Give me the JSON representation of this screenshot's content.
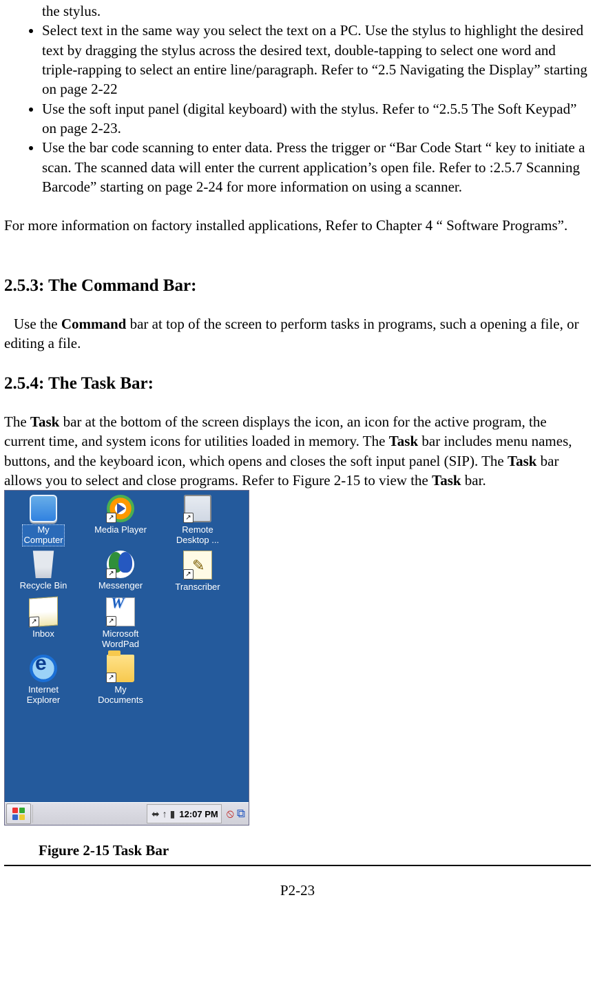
{
  "bullets": {
    "partial": "the stylus.",
    "b1": "Select text in the same way you select the text on a PC. Use the stylus to highlight the desired text by dragging the stylus across the desired text, double-tapping to select one word and triple-rapping to select an entire line/paragraph. Refer to “2.5 Navigating the Display” starting on page 2-22",
    "b2": "Use the soft input panel (digital keyboard) with the stylus. Refer to “2.5.5 The Soft Keypad” on page 2-23.",
    "b3": "Use the bar code scanning to enter data. Press the trigger or “Bar Code Start “ key to initiate a scan. The scanned data will enter the current application’s open file. Refer to :2.5.7 Scanning Barcode” starting on page 2-24 for more information on using a scanner."
  },
  "para_more_info": "For more information on factory installed applications, Refer to Chapter 4 “ Software Programs”.",
  "heading_253": "2.5.3: The Command Bar:",
  "para_253_pre": "Use the ",
  "para_253_bold": "Command",
  "para_253_post": " bar at top of the screen to perform tasks in programs, such a opening a file, or editing a file.",
  "heading_254": "2.5.4: The Task Bar:",
  "para_254_seg1a": "The ",
  "para_254_seg1b": "Task",
  "para_254_seg1c": " bar at the bottom of the screen displays the icon, an icon for the active program, the current time, and system icons for utilities loaded in memory. The ",
  "para_254_seg2b": "Task",
  "para_254_seg2c": " bar includes menu names, buttons, and the keyboard icon, which opens and closes the soft input panel (SIP). The ",
  "para_254_seg3b": "Task",
  "para_254_seg3c": " bar allows you to select and close programs. Refer to Figure 2-15 to view the ",
  "para_254_seg4b": "Task",
  "para_254_seg4c": " bar.",
  "device": {
    "icons": {
      "r0c0": "My\nComputer",
      "r0c1": "Media Player",
      "r0c2": "Remote\nDesktop ...",
      "r1c0": "Recycle Bin",
      "r1c1": "Messenger",
      "r1c2": "Transcriber",
      "r2c0": "Inbox",
      "r2c1": "Microsoft\nWordPad",
      "r3c0": "Internet\nExplorer",
      "r3c1": "My\nDocuments"
    },
    "tray": {
      "clock": "12:07 PM",
      "conn": "⬌",
      "up": "↑",
      "batt": "▮",
      "net_off": "⦸",
      "cascade": "⧉"
    }
  },
  "caption": "Figure 2-15 Task Bar",
  "page_number": "P2-23"
}
